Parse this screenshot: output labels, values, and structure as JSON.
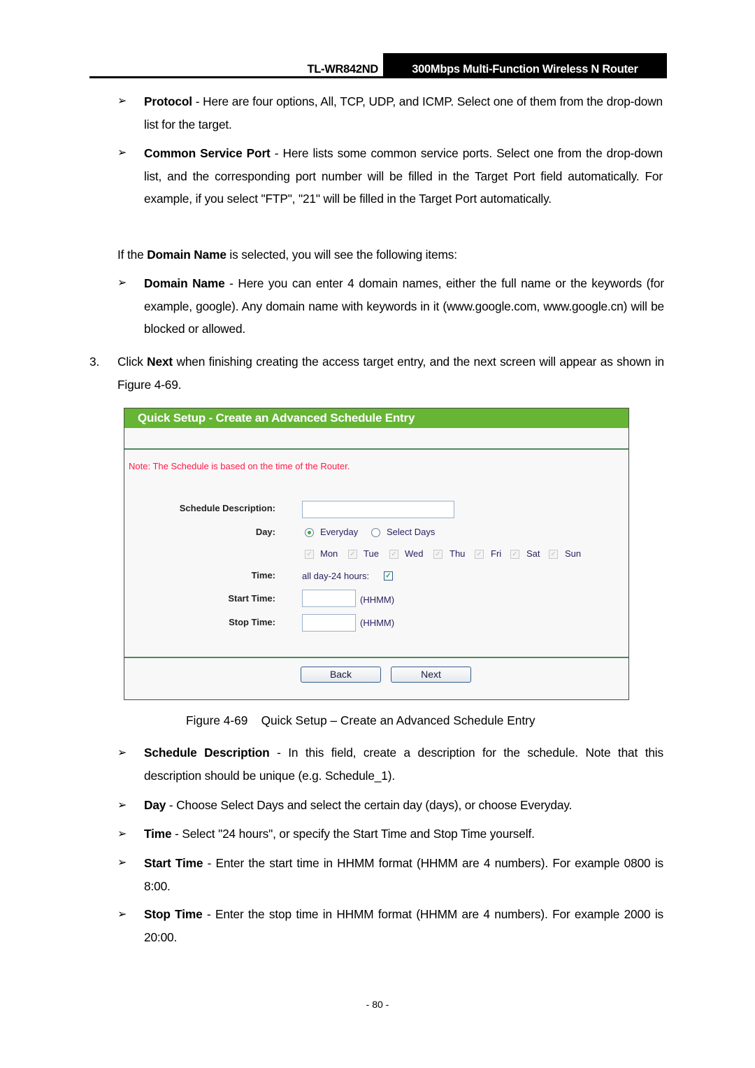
{
  "header": {
    "model": "TL-WR842ND",
    "product": "300Mbps Multi-Function Wireless N Router"
  },
  "bullet_glyph": "➢",
  "intro_items": [
    {
      "term": "Protocol",
      "text": " - Here are four options, All, TCP, UDP, and ICMP. Select one of them from the drop-down list for the target."
    },
    {
      "term": "Common Service Port",
      "text": " - Here lists some common service ports. Select one from the drop-down list, and the corresponding port number will be filled in the Target Port field automatically. For example, if you select \"FTP\", \"21\" will be filled in the Target Port automatically."
    }
  ],
  "domain_intro": {
    "pre": "If the ",
    "term": "Domain Name",
    "post": " is selected, you will see the following items:"
  },
  "domain_item": {
    "term": "Domain Name",
    "text": " - Here you can enter 4 domain names, either the full name or the keywords (for example, google). Any domain name with keywords in it (www.google.com, www.google.cn) will be blocked or allowed."
  },
  "step3": {
    "num": "3.",
    "pre": "Click ",
    "term": "Next",
    "post": " when finishing creating the access target entry, and the next screen will appear as shown in Figure 4-69."
  },
  "figure": {
    "title": "Quick Setup - Create an Advanced Schedule Entry",
    "note": "Note: The Schedule is based on the time of the Router.",
    "labels": {
      "description": "Schedule Description:",
      "day": "Day:",
      "time": "Time:",
      "start": "Start Time:",
      "stop": "Stop Time:"
    },
    "description_value": "",
    "day_options": [
      {
        "label": "Everyday",
        "selected": true
      },
      {
        "label": "Select Days",
        "selected": false
      }
    ],
    "days": [
      {
        "label": "Mon",
        "checked": true
      },
      {
        "label": "Tue",
        "checked": true
      },
      {
        "label": "Wed",
        "checked": true
      },
      {
        "label": "Thu",
        "checked": true
      },
      {
        "label": "Fri",
        "checked": true
      },
      {
        "label": "Sat",
        "checked": true
      },
      {
        "label": "Sun",
        "checked": true
      }
    ],
    "all_day_label": "all day-24 hours:",
    "all_day_checked": true,
    "start_value": "",
    "stop_value": "",
    "format_hint": "(HHMM)",
    "buttons": {
      "back": "Back",
      "next": "Next"
    }
  },
  "caption": "Figure 4-69    Quick Setup – Create an Advanced Schedule Entry",
  "field_items": [
    {
      "term": "Schedule Description",
      "text": " - In this field, create a description for the schedule. Note that this description should be unique (e.g. Schedule_1)."
    },
    {
      "term": "Day",
      "text": " - Choose Select Days and select the certain day (days), or choose Everyday."
    },
    {
      "term": "Time",
      "text": " - Select \"24 hours\", or specify the Start Time and Stop Time yourself."
    },
    {
      "term": "Start Time",
      "text": " - Enter the start time in HHMM format (HHMM are 4 numbers). For example 0800 is 8:00."
    },
    {
      "term": "Stop Time",
      "text": " - Enter the stop time in HHMM format (HHMM are 4 numbers). For example 2000 is 20:00."
    }
  ],
  "page_number": "- 80 -",
  "colors": {
    "title_bar": "#66b534",
    "note": "#ff1a45",
    "separator": "#4d8a5c"
  }
}
